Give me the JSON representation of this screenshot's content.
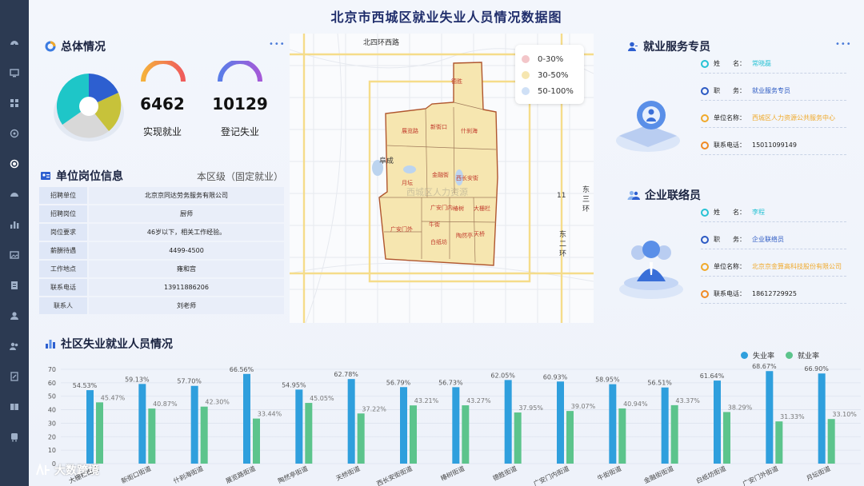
{
  "title": "北京市西城区就业失业人员情况数据图",
  "summary": {
    "heading": "总体情况",
    "employed_value": "6462",
    "employed_label": "实现就业",
    "registered_value": "10129",
    "registered_label": "登记失业"
  },
  "job": {
    "heading": "单位岗位信息",
    "scope": "本区级（固定就业）",
    "rows": [
      {
        "k": "招聘单位",
        "v": "北京京同达劳务服务有限公司"
      },
      {
        "k": "招聘岗位",
        "v": "厨师"
      },
      {
        "k": "岗位要求",
        "v": "46岁以下，相关工作经验。"
      },
      {
        "k": "薪酬待遇",
        "v": "4499-4500"
      },
      {
        "k": "工作地点",
        "v": "雍和宫"
      },
      {
        "k": "联系电话",
        "v": "13911886206"
      },
      {
        "k": "联系人",
        "v": "刘老师"
      }
    ]
  },
  "map": {
    "road_label": "北四环西路",
    "place_label": "阜成",
    "east_ring_1": "东三环",
    "east_ring_2": "东二环",
    "num_label": "11",
    "center_label": "西城区人力资源",
    "legend": [
      {
        "label": "0-30%",
        "color": "#f3c6c9"
      },
      {
        "label": "30-50%",
        "color": "#f6e6b0"
      },
      {
        "label": "50-100%",
        "color": "#cfe0f6"
      }
    ],
    "districts": [
      "德胜",
      "展览路",
      "新街口",
      "什刹海",
      "月坛",
      "金融街",
      "西长安街",
      "广安门内",
      "椿树",
      "大栅栏",
      "广安门外",
      "牛街",
      "陶然亭",
      "天桥",
      "白纸坊"
    ]
  },
  "specialist": {
    "heading": "就业服务专员",
    "rows": [
      {
        "k": "姓　　名：",
        "v": "常晓磊",
        "ring": "#27c2d4",
        "vcolor": "#27c2d4"
      },
      {
        "k": "职　　务：",
        "v": "就业服务专员",
        "ring": "#2b59c3",
        "vcolor": "#2b59c3"
      },
      {
        "k": "单位名称：",
        "v": "西城区人力资源公共服务中心",
        "ring": "#f0a92a",
        "vcolor": "#f0a92a"
      },
      {
        "k": "联系电话：",
        "v": "15011099149",
        "ring": "#f08a24",
        "vcolor": "#222"
      }
    ]
  },
  "liaison": {
    "heading": "企业联络员",
    "rows": [
      {
        "k": "姓　　名：",
        "v": "李程",
        "ring": "#27c2d4",
        "vcolor": "#27c2d4"
      },
      {
        "k": "职　　务：",
        "v": "企业联络员",
        "ring": "#2b59c3",
        "vcolor": "#2b59c3"
      },
      {
        "k": "单位名称：",
        "v": "北京京金算高科技股份有限公司",
        "ring": "#f0a92a",
        "vcolor": "#f0a92a"
      },
      {
        "k": "联系电话：",
        "v": "18612729925",
        "ring": "#f08a24",
        "vcolor": "#222"
      }
    ]
  },
  "chart_heading": "社区失业就业人员情况",
  "watermark": "大数跨境",
  "colors": {
    "unemp": "#2f9fdd",
    "emp": "#5cc48c"
  },
  "chart_data": {
    "type": "bar",
    "categories": [
      "大栅栏街道",
      "新街口街道",
      "什刹海街道",
      "展览路街道",
      "陶然亭街道",
      "天桥街道",
      "西长安街街道",
      "椿树街道",
      "德胜街道",
      "广安门内街道",
      "牛街街道",
      "金融街街道",
      "白纸坊街道",
      "广安门外街道",
      "月坛街道"
    ],
    "series": [
      {
        "name": "失业率",
        "values": [
          54.53,
          59.13,
          57.7,
          66.56,
          54.95,
          62.78,
          56.79,
          56.73,
          62.05,
          60.93,
          58.95,
          56.51,
          61.64,
          68.67,
          66.9
        ]
      },
      {
        "name": "就业率",
        "values": [
          45.47,
          40.87,
          42.3,
          33.44,
          45.05,
          37.22,
          43.21,
          43.27,
          37.95,
          39.07,
          40.94,
          43.37,
          38.29,
          31.33,
          33.1
        ]
      }
    ],
    "ylim": [
      0,
      70
    ],
    "yticks": [
      0,
      10,
      20,
      30,
      40,
      50,
      60,
      70
    ],
    "legend_position": "top-right",
    "grid": true
  }
}
